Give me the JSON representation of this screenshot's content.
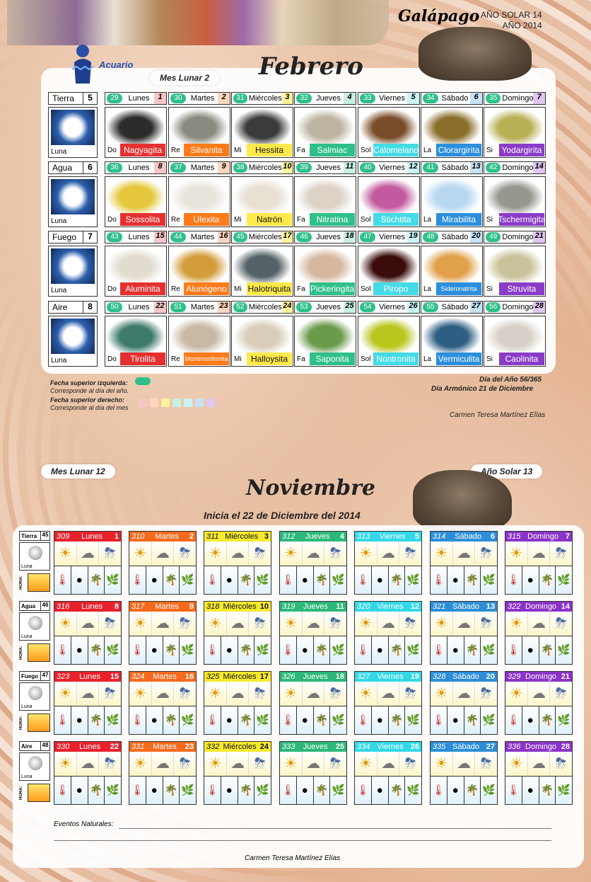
{
  "header": {
    "brand": "Galápago",
    "solar_year_line": "AÑO SOLAR 14",
    "year_line": "AÑO 2014",
    "sign": "Acuario",
    "lunar_month": "Mes Lunar 2",
    "month_title": "Febrero"
  },
  "febrero": {
    "weeks": [
      {
        "label": "Tierra",
        "num": "5",
        "moon": "Luna",
        "days": [
          {
            "c": "29",
            "d": "Lunes",
            "n": "1"
          },
          {
            "c": "30",
            "d": "Martes",
            "n": "2"
          },
          {
            "c": "31",
            "d": "Miércoles",
            "n": "3"
          },
          {
            "c": "32",
            "d": "Jueves",
            "n": "4"
          },
          {
            "c": "33",
            "d": "Viernes",
            "n": "5"
          },
          {
            "c": "34",
            "d": "Sábado",
            "n": "6"
          },
          {
            "c": "35",
            "d": "Domingo",
            "n": "7"
          }
        ],
        "minerals": [
          {
            "t": "Do",
            "nm": "Nagyagita"
          },
          {
            "t": "Re",
            "nm": "Silvanita"
          },
          {
            "t": "Mi",
            "nm": "Hessita"
          },
          {
            "t": "Fa",
            "nm": "Salmiac"
          },
          {
            "t": "Sol",
            "nm": "Calomelano"
          },
          {
            "t": "La",
            "nm": "Clorargirita"
          },
          {
            "t": "Si",
            "nm": "Yodargirita"
          }
        ]
      },
      {
        "label": "Agua",
        "num": "6",
        "moon": "Luna",
        "days": [
          {
            "c": "36",
            "d": "Lunes",
            "n": "8"
          },
          {
            "c": "37",
            "d": "Martes",
            "n": "9"
          },
          {
            "c": "38",
            "d": "Miércoles",
            "n": "10"
          },
          {
            "c": "39",
            "d": "Jueves",
            "n": "11"
          },
          {
            "c": "40",
            "d": "Viernes",
            "n": "12"
          },
          {
            "c": "41",
            "d": "Sábado",
            "n": "13"
          },
          {
            "c": "42",
            "d": "Domingo",
            "n": "14"
          }
        ],
        "minerals": [
          {
            "t": "Do",
            "nm": "Sossolita"
          },
          {
            "t": "Re",
            "nm": "Ulexita"
          },
          {
            "t": "Mi",
            "nm": "Natrón"
          },
          {
            "t": "Fa",
            "nm": "Nitratina"
          },
          {
            "t": "Sol",
            "nm": "Stichtita"
          },
          {
            "t": "La",
            "nm": "Mirabilita"
          },
          {
            "t": "Si",
            "nm": "Tschermigita"
          }
        ]
      },
      {
        "label": "Fuego",
        "num": "7",
        "moon": "Luna",
        "days": [
          {
            "c": "43",
            "d": "Lunes",
            "n": "15"
          },
          {
            "c": "44",
            "d": "Martes",
            "n": "16"
          },
          {
            "c": "45",
            "d": "Miércoles",
            "n": "17"
          },
          {
            "c": "46",
            "d": "Jueves",
            "n": "18"
          },
          {
            "c": "47",
            "d": "Viernes",
            "n": "19"
          },
          {
            "c": "48",
            "d": "Sábado",
            "n": "20"
          },
          {
            "c": "49",
            "d": "Domingo",
            "n": "21"
          }
        ],
        "minerals": [
          {
            "t": "Do",
            "nm": "Aluminita"
          },
          {
            "t": "Re",
            "nm": "Alunógeno"
          },
          {
            "t": "Mi",
            "nm": "Halotriquita"
          },
          {
            "t": "Fa",
            "nm": "Pickeringita"
          },
          {
            "t": "Sol",
            "nm": "Piropo"
          },
          {
            "t": "La",
            "nm": "Sideronatrita"
          },
          {
            "t": "Si",
            "nm": "Struvita"
          }
        ]
      },
      {
        "label": "Aire",
        "num": "8",
        "moon": "Luna",
        "days": [
          {
            "c": "50",
            "d": "Lunes",
            "n": "22"
          },
          {
            "c": "51",
            "d": "Martes",
            "n": "23"
          },
          {
            "c": "52",
            "d": "Miércoles",
            "n": "24"
          },
          {
            "c": "53",
            "d": "Jueves",
            "n": "25"
          },
          {
            "c": "54",
            "d": "Viernes",
            "n": "26"
          },
          {
            "c": "55",
            "d": "Sábado",
            "n": "27"
          },
          {
            "c": "56",
            "d": "Domingo",
            "n": "28"
          }
        ],
        "minerals": [
          {
            "t": "Do",
            "nm": "Tirolita"
          },
          {
            "t": "Re",
            "nm": "Montmorillonita"
          },
          {
            "t": "Mi",
            "nm": "Halloysita"
          },
          {
            "t": "Fa",
            "nm": "Saponita"
          },
          {
            "t": "Sol",
            "nm": "Nontronita"
          },
          {
            "t": "La",
            "nm": "Vermiculita"
          },
          {
            "t": "Si",
            "nm": "Caolinita"
          }
        ]
      }
    ],
    "note_colors": [
      "#e63030",
      "#ff7a1a",
      "#ffe94a",
      "#2fc08a",
      "#44dbe6",
      "#2b8fdd",
      "#8a3cc8"
    ],
    "day_num_bg": [
      "#f6c6c6",
      "#ffd6bf",
      "#fff39b",
      "#c8efe0",
      "#c9f3f6",
      "#c7e1f6",
      "#dfc7f0"
    ]
  },
  "legend": {
    "left_title": "Fecha superior izquierda:",
    "left_desc": "Corresponde al día del año.",
    "right_title": "Fecha superior derecho:",
    "right_desc": "Corresponde al día del mes",
    "day_of_year": "Día del Año 56/365",
    "harmonic_day": "Día Armónico 21 de Diciembre",
    "author": "Carmen Teresa Martínez Elías"
  },
  "noviembre": {
    "lunar_month": "Mes Lunar 12",
    "solar_year": "Año Solar 13",
    "title": "Noviembre",
    "subtitle": "Inicia el 22 de Diciembre del 2014",
    "weeks": [
      {
        "label": "Tierra",
        "num": "45",
        "moon": "Luna",
        "hora": "HORA:",
        "days": [
          {
            "y": "309",
            "d": "Lunes",
            "n": "1"
          },
          {
            "y": "310",
            "d": "Martes",
            "n": "2"
          },
          {
            "y": "311",
            "d": "Miércoles",
            "n": "3"
          },
          {
            "y": "312",
            "d": "Jueves",
            "n": "4"
          },
          {
            "y": "313",
            "d": "Viernes",
            "n": "5"
          },
          {
            "y": "314",
            "d": "Sábado",
            "n": "6"
          },
          {
            "y": "315",
            "d": "Domingo",
            "n": "7"
          }
        ]
      },
      {
        "label": "Agua",
        "num": "46",
        "moon": "Luna",
        "hora": "HORA:",
        "days": [
          {
            "y": "316",
            "d": "Lunes",
            "n": "8"
          },
          {
            "y": "317",
            "d": "Martes",
            "n": "9"
          },
          {
            "y": "318",
            "d": "Miércoles",
            "n": "10"
          },
          {
            "y": "319",
            "d": "Jueves",
            "n": "11"
          },
          {
            "y": "320",
            "d": "Viernes",
            "n": "12"
          },
          {
            "y": "321",
            "d": "Sábado",
            "n": "13"
          },
          {
            "y": "322",
            "d": "Domingo",
            "n": "14"
          }
        ]
      },
      {
        "label": "Fuego",
        "num": "47",
        "moon": "Luna",
        "hora": "HORA:",
        "days": [
          {
            "y": "323",
            "d": "Lunes",
            "n": "15"
          },
          {
            "y": "324",
            "d": "Martes",
            "n": "16"
          },
          {
            "y": "325",
            "d": "Miércoles",
            "n": "17"
          },
          {
            "y": "326",
            "d": "Jueves",
            "n": "18"
          },
          {
            "y": "327",
            "d": "Viernes",
            "n": "19"
          },
          {
            "y": "328",
            "d": "Sábado",
            "n": "20"
          },
          {
            "y": "329",
            "d": "Domingo",
            "n": "21"
          }
        ]
      },
      {
        "label": "Aire",
        "num": "48",
        "moon": "Luna",
        "hora": "HORA:",
        "days": [
          {
            "y": "330",
            "d": "Lunes",
            "n": "22"
          },
          {
            "y": "331",
            "d": "Martes",
            "n": "23"
          },
          {
            "y": "332",
            "d": "Miércoles",
            "n": "24"
          },
          {
            "y": "333",
            "d": "Jueves",
            "n": "25"
          },
          {
            "y": "334",
            "d": "Viernes",
            "n": "26"
          },
          {
            "y": "335",
            "d": "Sábado",
            "n": "27"
          },
          {
            "y": "336",
            "d": "Domingo",
            "n": "28"
          }
        ]
      }
    ],
    "header_colors": [
      "#e8212b",
      "#f56a1c",
      "#f7ea2e",
      "#2cb87a",
      "#33d8e6",
      "#2c8ed8",
      "#8b33c8"
    ],
    "header_text": [
      "#ffffff",
      "#ffffff",
      "#111111",
      "#ffffff",
      "#ffffff",
      "#ffffff",
      "#ffffff"
    ],
    "weather_icons_top": [
      "☀",
      "☁",
      "⛈"
    ],
    "weather_icons_bottom": [
      "🌡",
      "●",
      "🌴",
      "🌿"
    ],
    "events_label": "Eventos Naturales:",
    "author": "Carmen Teresa Martínez Elías"
  }
}
